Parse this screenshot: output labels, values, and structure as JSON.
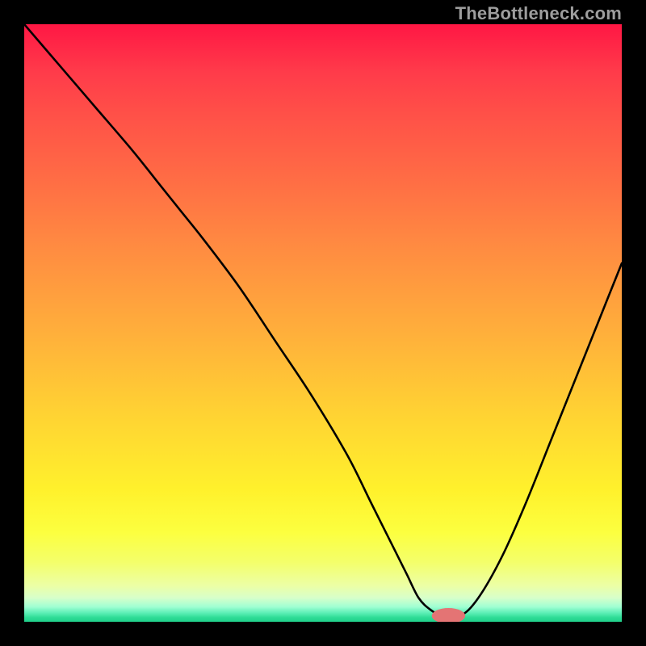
{
  "watermark": "TheBottleneck.com",
  "colors": {
    "background": "#000000",
    "curve_stroke": "#000000",
    "marker_fill": "#e47474",
    "watermark_text": "#9d9d9d"
  },
  "chart_data": {
    "type": "line",
    "title": "",
    "xlabel": "",
    "ylabel": "",
    "xlim": [
      0,
      100
    ],
    "ylim": [
      0,
      100
    ],
    "grid": false,
    "legend": false,
    "gradient_stops": [
      {
        "pos": 0,
        "color": "#ff1744"
      },
      {
        "pos": 8,
        "color": "#ff3b4a"
      },
      {
        "pos": 15,
        "color": "#ff5048"
      },
      {
        "pos": 25,
        "color": "#ff6a45"
      },
      {
        "pos": 38,
        "color": "#ff8d41"
      },
      {
        "pos": 52,
        "color": "#ffb03b"
      },
      {
        "pos": 65,
        "color": "#ffd233"
      },
      {
        "pos": 78,
        "color": "#fff12c"
      },
      {
        "pos": 85,
        "color": "#fcff3f"
      },
      {
        "pos": 90,
        "color": "#f4ff6a"
      },
      {
        "pos": 94,
        "color": "#ecffa6"
      },
      {
        "pos": 96,
        "color": "#d7ffca"
      },
      {
        "pos": 97.5,
        "color": "#a0ffd3"
      },
      {
        "pos": 98.5,
        "color": "#5eefb6"
      },
      {
        "pos": 99.3,
        "color": "#2edc96"
      },
      {
        "pos": 100,
        "color": "#20cf8a"
      }
    ],
    "series": [
      {
        "name": "bottleneck-curve",
        "x": [
          0,
          6,
          12,
          18,
          22,
          26,
          30,
          36,
          42,
          48,
          54,
          58,
          62,
          64,
          66,
          68,
          70,
          73,
          76,
          80,
          84,
          88,
          92,
          96,
          100
        ],
        "y": [
          100,
          93,
          86,
          79,
          74,
          69,
          64,
          56,
          47,
          38,
          28,
          20,
          12,
          8,
          4,
          2,
          1,
          1,
          4,
          11,
          20,
          30,
          40,
          50,
          60
        ]
      }
    ],
    "marker": {
      "x": 71,
      "y": 1,
      "rx": 2.8,
      "ry": 1.3
    },
    "notes": "y=0 is the bottom edge (green); y=100 is the top edge (red). Curve descends from top-left, has a flat minimum near x≈70, then rises toward top-right. The pink marker sits at the valley floor."
  }
}
